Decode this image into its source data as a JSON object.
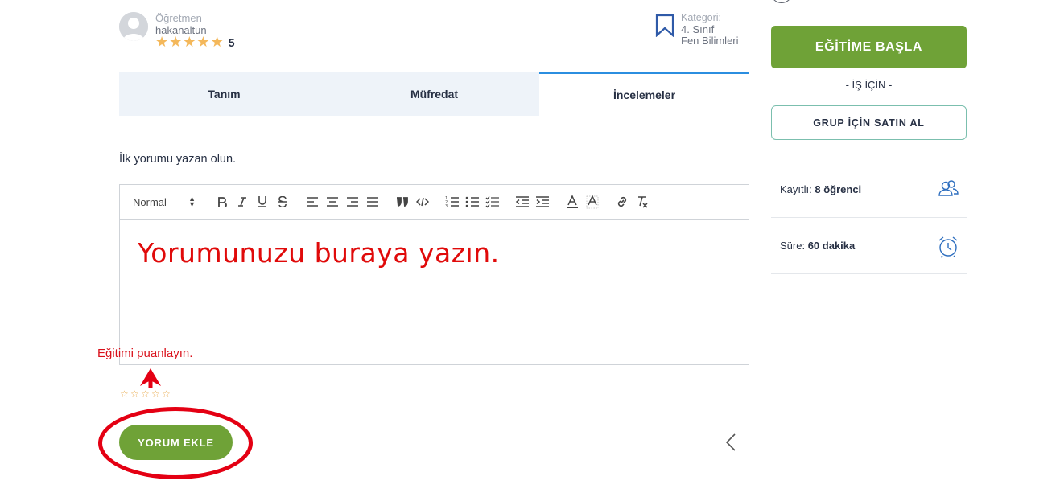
{
  "instructor": {
    "role_label": "Öğretmen",
    "name": "hakanaltun",
    "stars": [
      "★",
      "★",
      "★",
      "★",
      "★"
    ],
    "rating": "5"
  },
  "category": {
    "label": "Kategori:",
    "value_line1": "4. Sınıf",
    "value_line2": "Fen Bilimleri",
    "icon": "bookmark-icon"
  },
  "tabs": [
    {
      "label": "Tanım",
      "active": false
    },
    {
      "label": "Müfredat",
      "active": false
    },
    {
      "label": "İncelemeler",
      "active": true
    }
  ],
  "reviews": {
    "first_review_text": "İlk yorumu yazan olun.",
    "editor": {
      "format_value": "Normal",
      "placeholder_annotation": "Yorumunuzu buraya yazın.",
      "toolbar_icons": [
        "bold-icon",
        "italic-icon",
        "underline-icon",
        "strike-icon",
        "align-left-icon",
        "align-center-icon",
        "align-right-icon",
        "align-justify-icon",
        "blockquote-icon",
        "code-icon",
        "ordered-list-icon",
        "bullet-list-icon",
        "check-list-icon",
        "outdent-icon",
        "indent-icon",
        "text-color-icon",
        "background-color-icon",
        "link-icon",
        "clear-format-icon"
      ]
    },
    "rate_hint": "Eğitimi puanlayın.",
    "rate_stars": [
      "☆",
      "☆",
      "☆",
      "☆",
      "☆"
    ],
    "add_review_label": "YORUM EKLE"
  },
  "sidebar": {
    "start_label": "EĞİTİME BAŞLA",
    "for_business": "- İŞ İÇİN -",
    "group_buy_label": "GRUP İÇİN SATIN AL",
    "enrolled_label": "Kayıtlı:",
    "enrolled_value": "8 öğrenci",
    "duration_label": "Süre:",
    "duration_value": "60 dakika"
  },
  "colors": {
    "accent_green": "#6fa237",
    "annotation_red": "#e40013",
    "tab_active_border": "#2b8ee0",
    "star": "#f4b85b"
  }
}
